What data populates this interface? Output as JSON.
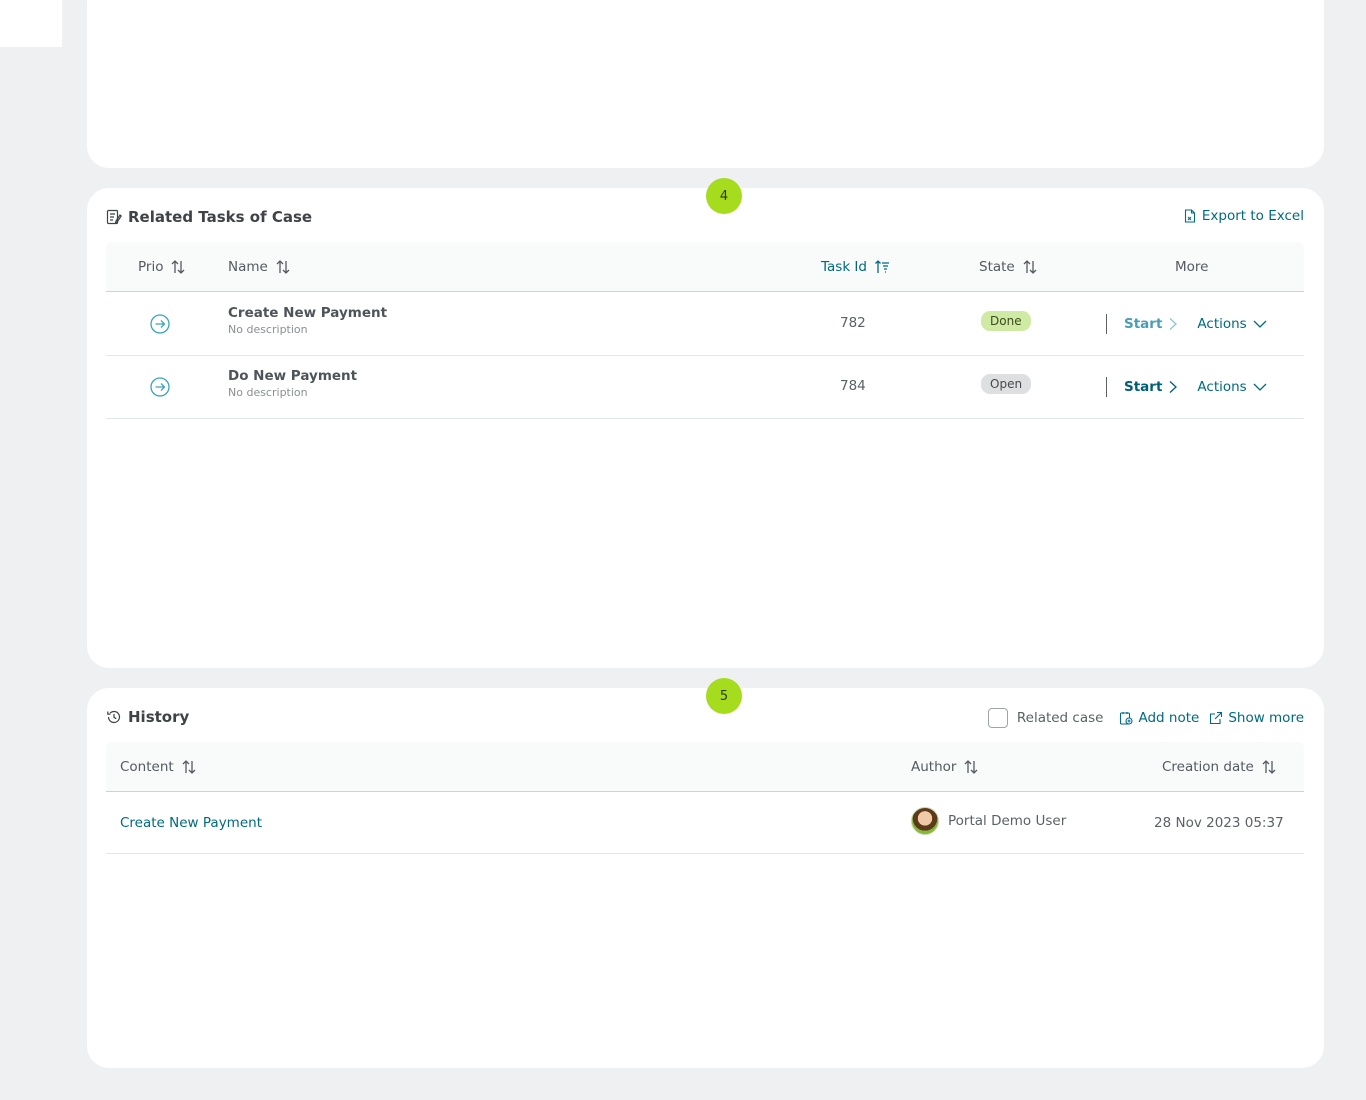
{
  "tasks_panel": {
    "step": "4",
    "title": "Related Tasks of Case",
    "export_label": "Export to Excel",
    "columns": {
      "prio": "Prio",
      "name": "Name",
      "task_id": "Task Id",
      "state": "State",
      "more": "More"
    },
    "rows": [
      {
        "name": "Create New Payment",
        "description": "No description",
        "task_id": "782",
        "state": "Done",
        "start_label": "Start",
        "actions_label": "Actions"
      },
      {
        "name": "Do New Payment",
        "description": "No description",
        "task_id": "784",
        "state": "Open",
        "start_label": "Start",
        "actions_label": "Actions"
      }
    ]
  },
  "history_panel": {
    "step": "5",
    "title": "History",
    "related_case_label": "Related case",
    "related_case_checked": false,
    "add_note_label": "Add note",
    "show_more_label": "Show more",
    "columns": {
      "content": "Content",
      "author": "Author",
      "creation_date": "Creation date"
    },
    "rows": [
      {
        "content": "Create New Payment",
        "author": "Portal Demo User",
        "creation_date": "28 Nov 2023 05:37"
      }
    ]
  },
  "colors": {
    "accent": "#006a80",
    "step_badge": "#a6dc1e",
    "done_badge": "#cfeaa3",
    "open_badge": "#dddfe1"
  }
}
